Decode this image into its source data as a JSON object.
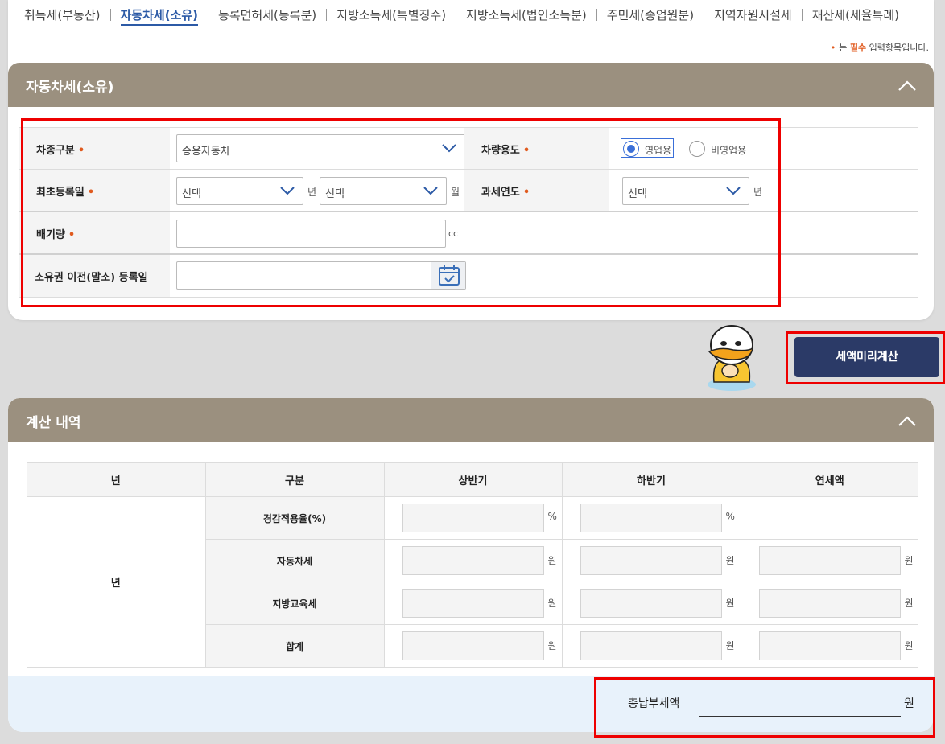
{
  "tabs": [
    {
      "label": "취득세(부동산)",
      "active": false
    },
    {
      "label": "자동차세(소유)",
      "active": true
    },
    {
      "label": "등록면허세(등록분)",
      "active": false
    },
    {
      "label": "지방소득세(특별징수)",
      "active": false
    },
    {
      "label": "지방소득세(법인소득분)",
      "active": false
    },
    {
      "label": "주민세(종업원분)",
      "active": false
    },
    {
      "label": "지역자원시설세",
      "active": false
    },
    {
      "label": "재산세(세율특례)",
      "active": false
    }
  ],
  "required_note": {
    "dot": "•",
    "prefix": "는",
    "highlight": "필수",
    "suffix": "입력항목입니다."
  },
  "form_section": {
    "title": "자동차세(소유)",
    "fields": {
      "vehicle_type": {
        "label": "차종구분",
        "value": "승용자동차"
      },
      "vehicle_use": {
        "label": "차량용도",
        "options": [
          "영업용",
          "비영업용"
        ],
        "selected": "영업용"
      },
      "first_reg": {
        "label": "최초등록일",
        "year_value": "선택",
        "year_unit": "년",
        "month_value": "선택",
        "month_unit": "월"
      },
      "tax_year": {
        "label": "과세연도",
        "value": "선택",
        "unit": "년"
      },
      "displacement": {
        "label": "배기량",
        "value": "",
        "unit": "cc"
      },
      "transfer_date": {
        "label": "소유권 이전(말소) 등록일",
        "value": ""
      }
    },
    "required_mark": "•"
  },
  "calc_button": "세액미리계산",
  "result_section": {
    "title": "계산 내역",
    "headers": [
      "년",
      "구분",
      "상반기",
      "하반기",
      "연세액"
    ],
    "year_cell": "년",
    "rows": [
      {
        "label": "경감적용율(%)",
        "unit": "%",
        "annual": false
      },
      {
        "label": "자동차세",
        "unit": "원",
        "annual": true
      },
      {
        "label": "지방교육세",
        "unit": "원",
        "annual": true
      },
      {
        "label": "합계",
        "unit": "원",
        "annual": true
      }
    ],
    "total_label": "총납부세액",
    "total_unit": "원"
  },
  "colors": {
    "header_bg": "#9b907f",
    "accent": "#2b3a67",
    "required": "#e05a1e",
    "highlight": "#e00000",
    "total_bg": "#e8f2fb"
  }
}
